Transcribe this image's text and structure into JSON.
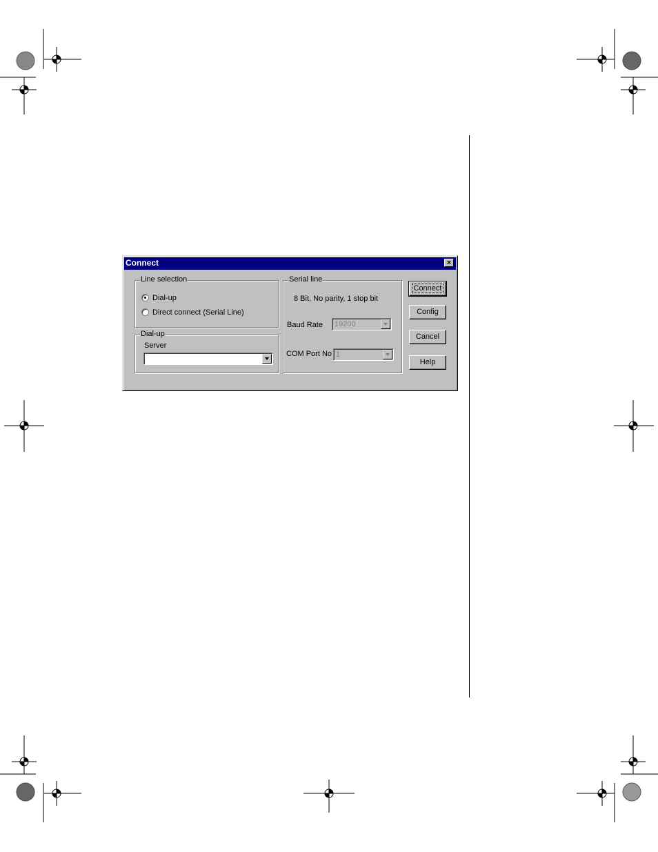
{
  "dialog": {
    "title": "Connect",
    "close_label": "×",
    "line_selection": {
      "label": "Line selection",
      "options": [
        {
          "label": "Dial-up",
          "selected": true
        },
        {
          "label": "Direct connect (Serial Line)",
          "selected": false
        }
      ]
    },
    "dialup": {
      "label": "Dial-up",
      "server_label": "Server",
      "server_value": ""
    },
    "serial_line": {
      "label": "Serial line",
      "settings_text": "8 Bit, No parity, 1 stop bit",
      "baud_rate_label": "Baud Rate",
      "baud_rate_value": "19200",
      "com_port_label": "COM Port No",
      "com_port_value": "1"
    },
    "buttons": {
      "connect": "Connect",
      "config": "Config",
      "cancel": "Cancel",
      "help": "Help"
    }
  },
  "colors": {
    "titlebar": "#000080",
    "face": "#c0c0c0"
  }
}
